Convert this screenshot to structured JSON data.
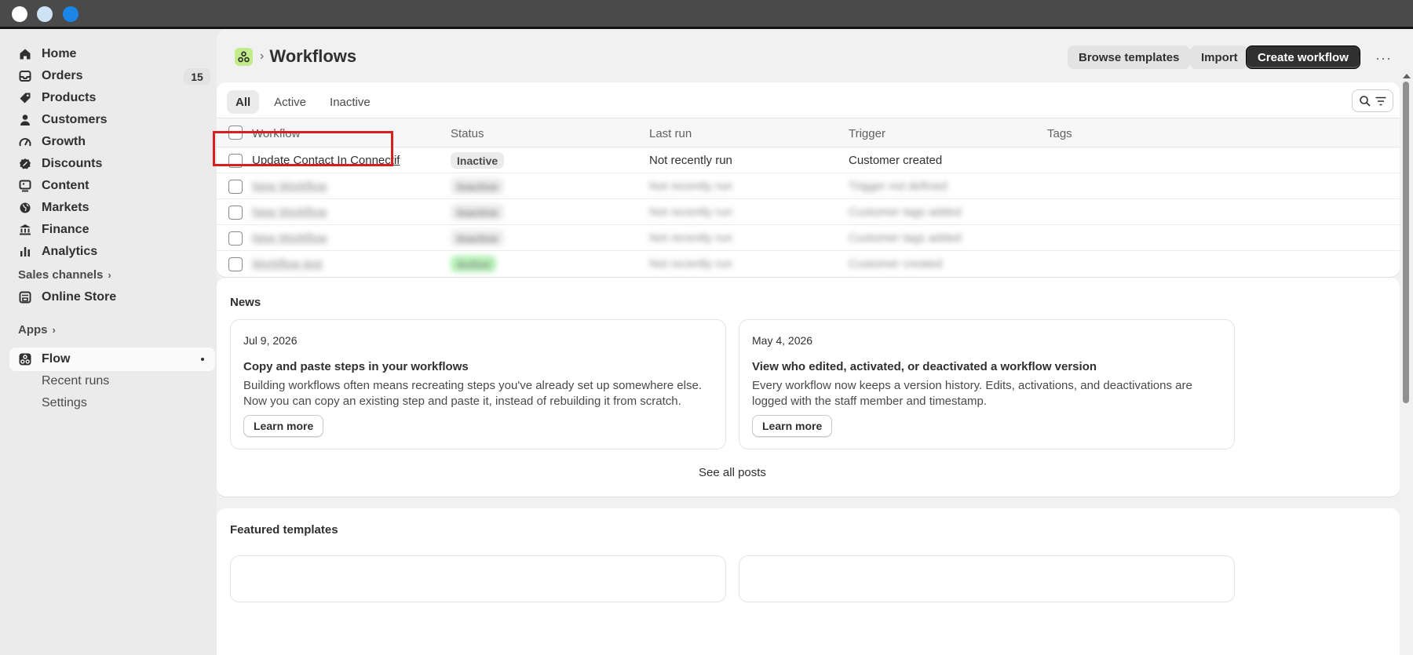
{
  "sidebar": {
    "items": [
      {
        "label": "Home",
        "icon": "home-icon"
      },
      {
        "label": "Orders",
        "icon": "inbox-icon",
        "count": "15"
      },
      {
        "label": "Products",
        "icon": "tag-icon"
      },
      {
        "label": "Customers",
        "icon": "person-icon"
      },
      {
        "label": "Growth",
        "icon": "gauge-icon"
      },
      {
        "label": "Discounts",
        "icon": "discount-icon"
      },
      {
        "label": "Content",
        "icon": "content-icon"
      },
      {
        "label": "Markets",
        "icon": "globe-icon"
      },
      {
        "label": "Finance",
        "icon": "bank-icon"
      },
      {
        "label": "Analytics",
        "icon": "bar-chart-icon"
      }
    ],
    "sales_channels": "Sales channels",
    "online_store": "Online Store",
    "apps": "Apps",
    "flow": "Flow",
    "recent_runs": "Recent runs",
    "settings": "Settings"
  },
  "header": {
    "title": "Workflows",
    "browse_templates": "Browse templates",
    "import": "Import",
    "create_workflow": "Create workflow",
    "more": "···"
  },
  "tabs": [
    "All",
    "Active",
    "Inactive"
  ],
  "table": {
    "columns": [
      "Workflow",
      "Status",
      "Last run",
      "Trigger",
      "Tags"
    ],
    "rows": [
      {
        "name": "Update Contact In Connectif",
        "status": "Inactive",
        "last_run": "Not recently run",
        "trigger": "Customer created"
      },
      {
        "name": "New Workflow",
        "status": "Inactive",
        "last_run": "Not recently run",
        "trigger": "Trigger not defined"
      },
      {
        "name": "New Workflow",
        "status": "Inactive",
        "last_run": "Not recently run",
        "trigger": "Customer tags added"
      },
      {
        "name": "New Workflow",
        "status": "Inactive",
        "last_run": "Not recently run",
        "trigger": "Customer tags added"
      },
      {
        "name": "Workflow test",
        "status": "Active",
        "last_run": "Not recently run",
        "trigger": "Customer created"
      }
    ]
  },
  "news": {
    "title": "News",
    "items": [
      {
        "date": "Jul 9, 2026",
        "headline": "Copy and paste steps in your workflows",
        "body": "Building workflows often means recreating steps you've already set up somewhere else. Now you can copy an existing step and paste it, instead of rebuilding it from scratch.",
        "cta": "Learn more"
      },
      {
        "date": "May 4, 2026",
        "headline": "View who edited, activated, or deactivated a workflow version",
        "body": "Every workflow now keeps a version history. Edits, activations, and deactivations are logged with the staff member and timestamp.",
        "cta": "Learn more"
      }
    ],
    "see_all": "See all posts"
  },
  "featured": {
    "title": "Featured templates"
  },
  "colors": {
    "accent": "#303030",
    "highlight": "#d71f1f",
    "active_badge": "#b4f0b6"
  }
}
